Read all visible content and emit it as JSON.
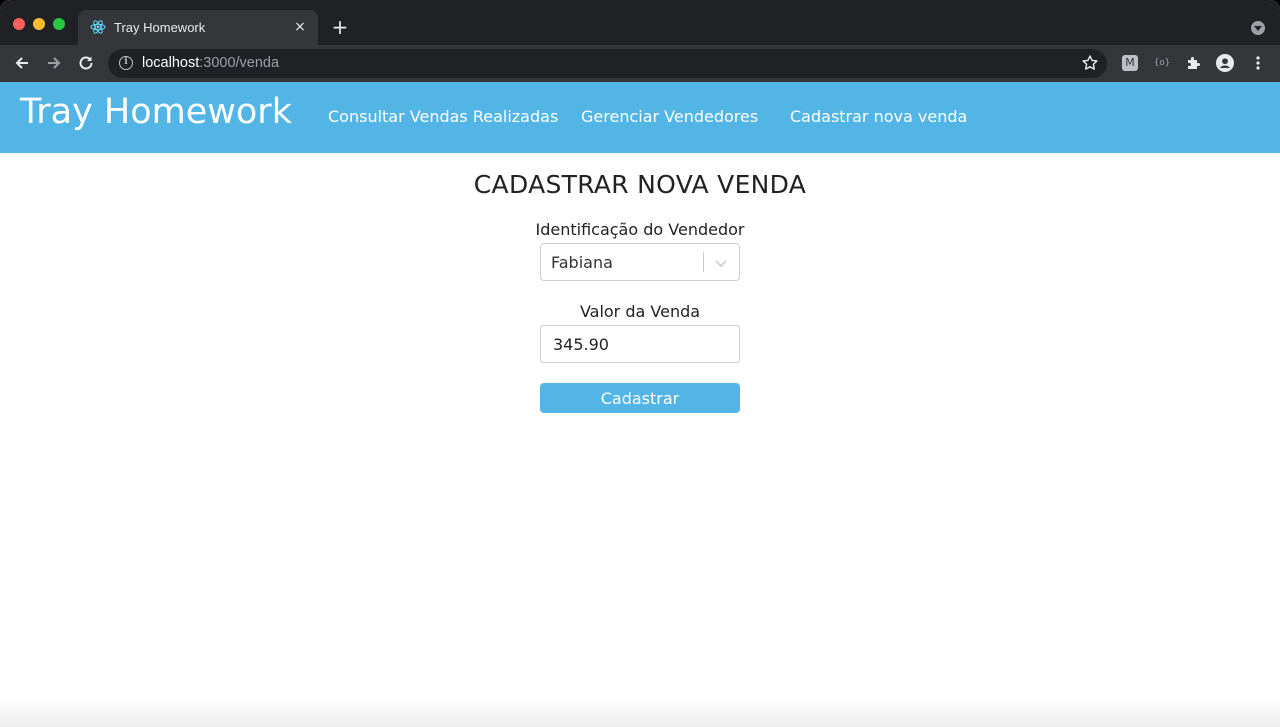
{
  "browser": {
    "tab_title": "Tray Homework",
    "tab_close": "×",
    "new_tab": "+",
    "url_host": "localhost",
    "url_path": ":3000/venda"
  },
  "header": {
    "brand": "Tray Homework",
    "nav": [
      {
        "label": "Consultar Vendas Realizadas"
      },
      {
        "label": "Gerenciar Vendedores"
      },
      {
        "label": "Cadastrar nova venda"
      }
    ]
  },
  "form": {
    "title": "CADASTRAR NOVA VENDA",
    "seller_label": "Identificação do Vendedor",
    "seller_value": "Fabiana",
    "value_label": "Valor da Venda",
    "value_input": "345.90",
    "submit_label": "Cadastrar"
  },
  "colors": {
    "accent": "#53b5e5",
    "chrome_dark": "#202124",
    "chrome_toolbar": "#35363a"
  }
}
